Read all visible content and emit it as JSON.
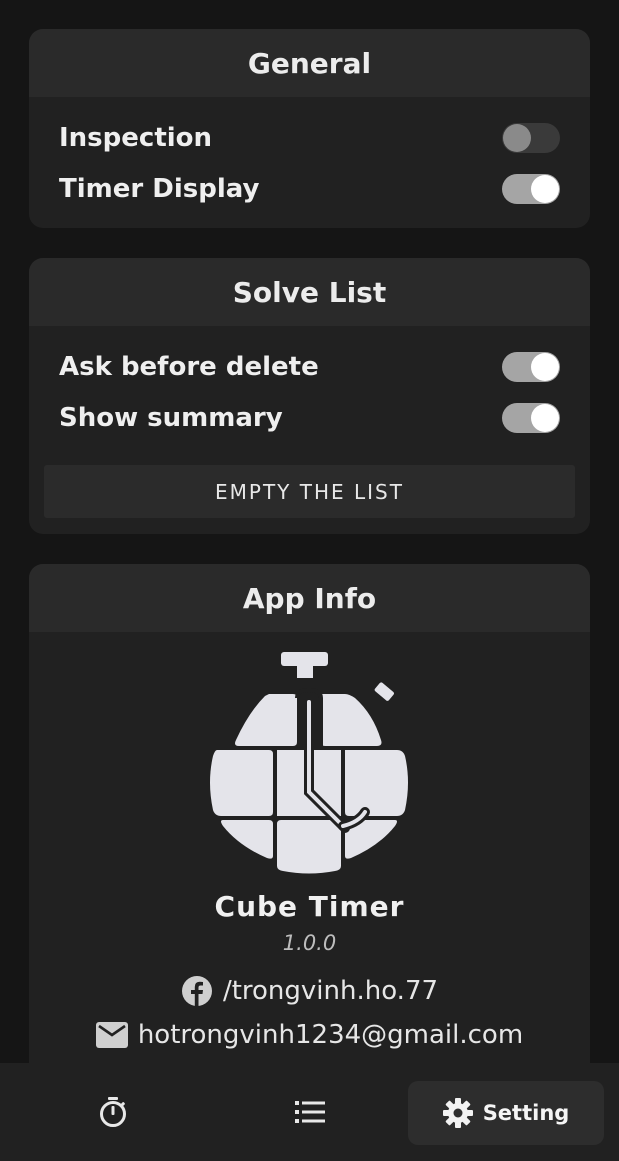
{
  "general": {
    "title": "General",
    "items": [
      {
        "label": "Inspection",
        "enabled": false
      },
      {
        "label": "Timer Display",
        "enabled": true
      }
    ]
  },
  "solve_list": {
    "title": "Solve List",
    "items": [
      {
        "label": "Ask before delete",
        "enabled": true
      },
      {
        "label": "Show summary",
        "enabled": true
      }
    ],
    "empty_button_label": "EMPTY THE LIST"
  },
  "app_info": {
    "title": "App Info",
    "app_name": "Cube Timer",
    "version": "1.0.0",
    "facebook": "/trongvinh.ho.77",
    "email": "hotrongvinh1234@gmail.com"
  },
  "nav": {
    "items": [
      {
        "icon": "stopwatch-icon"
      },
      {
        "icon": "list-icon"
      },
      {
        "icon": "gear-icon",
        "label": "Setting",
        "active": true
      }
    ]
  },
  "colors": {
    "background": "#151515",
    "card": "#212121",
    "card_header": "#2a2a2a",
    "toggle_on_track": "#a5a5a5",
    "toggle_off_track": "#3a3a3a"
  }
}
